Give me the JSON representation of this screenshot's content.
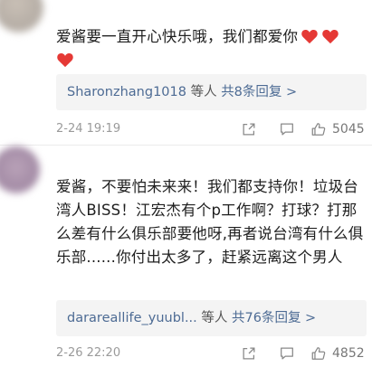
{
  "comments": [
    {
      "text": "爱酱要一直开心快乐哦，我们都爱你",
      "reply_user": "Sharonzhang1018",
      "reply_sep": " 等人 ",
      "reply_count": "共8条回复 >",
      "date": "2-24 19:19",
      "likes": "5045"
    },
    {
      "text": "爱酱，不要怕未来来！我们都支持你！垃圾台湾人BISS！江宏杰有个p工作啊？打球？打那么差有什么俱乐部要他呀,再者说台湾有什么俱乐部......你付出太多了，赶紧远离这个男人",
      "reply_user": "darareallife_yuubl...",
      "reply_sep": " 等人 ",
      "reply_count": "共76条回复 >",
      "date": "2-26 22:20",
      "likes": "4852"
    }
  ],
  "icons": {
    "heart": "heart-icon",
    "share": "share-icon",
    "comment": "comment-icon",
    "like": "thumbs-up-icon"
  },
  "colors": {
    "link": "#4d6b94",
    "heart": "#e53935",
    "meta": "#9a9a9a"
  }
}
